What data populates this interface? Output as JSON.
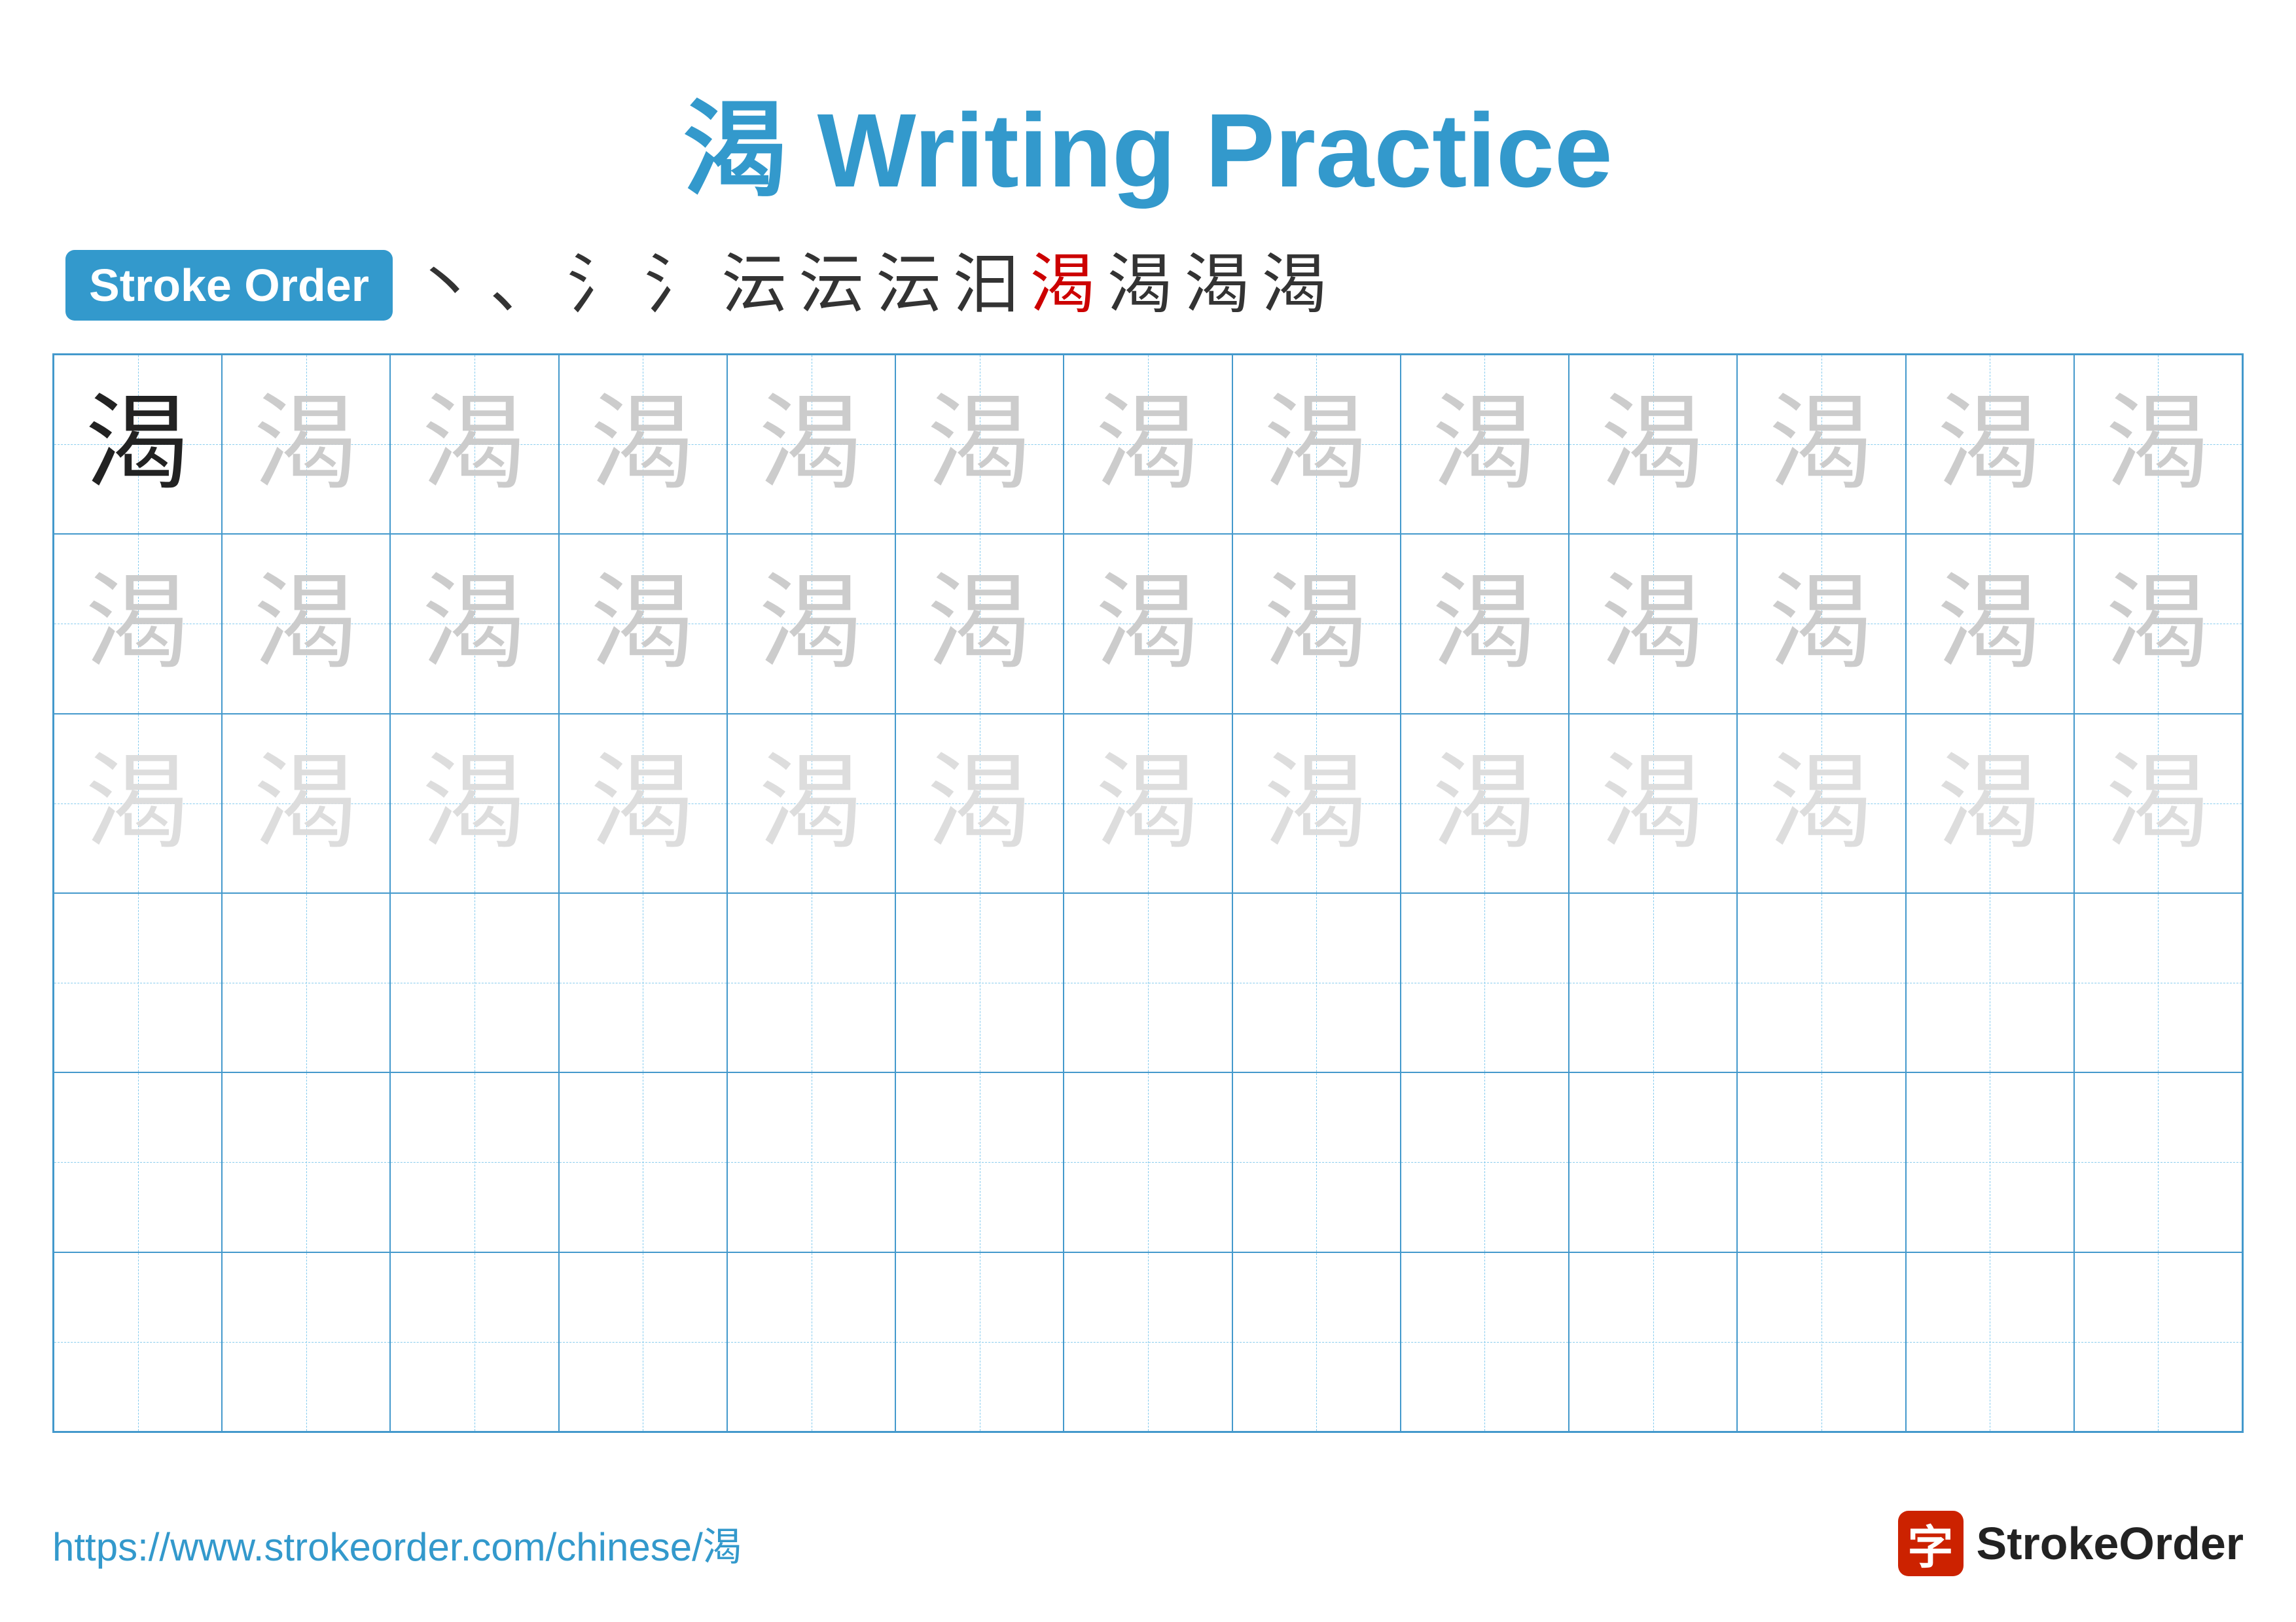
{
  "title": "渴 Writing Practice",
  "stroke_order_badge": "Stroke Order",
  "stroke_chars": [
    {
      "char": "丶",
      "style": "normal"
    },
    {
      "char": "丶",
      "style": "normal"
    },
    {
      "char": "氵",
      "style": "normal"
    },
    {
      "char": "氵",
      "style": "normal"
    },
    {
      "char": "氿",
      "style": "normal"
    },
    {
      "char": "氿",
      "style": "normal"
    },
    {
      "char": "汩",
      "style": "normal"
    },
    {
      "char": "汩",
      "style": "normal"
    },
    {
      "char": "渴",
      "style": "red"
    },
    {
      "char": "渴",
      "style": "normal"
    },
    {
      "char": "渴",
      "style": "normal"
    },
    {
      "char": "渴",
      "style": "normal"
    }
  ],
  "character": "渴",
  "grid_rows": 6,
  "grid_cols": 13,
  "footer_url": "https://www.strokeorder.com/chinese/渴",
  "footer_logo_char": "字",
  "footer_logo_text": "StrokeOrder",
  "row_styles": [
    [
      "solid",
      "light1",
      "light1",
      "light1",
      "light1",
      "light1",
      "light1",
      "light1",
      "light1",
      "light1",
      "light1",
      "light1",
      "light1"
    ],
    [
      "light1",
      "light1",
      "light1",
      "light1",
      "light1",
      "light1",
      "light1",
      "light1",
      "light1",
      "light1",
      "light1",
      "light1",
      "light1"
    ],
    [
      "light2",
      "light2",
      "light2",
      "light2",
      "light2",
      "light2",
      "light2",
      "light2",
      "light2",
      "light2",
      "light2",
      "light2",
      "light2"
    ],
    [
      "empty",
      "empty",
      "empty",
      "empty",
      "empty",
      "empty",
      "empty",
      "empty",
      "empty",
      "empty",
      "empty",
      "empty",
      "empty"
    ],
    [
      "empty",
      "empty",
      "empty",
      "empty",
      "empty",
      "empty",
      "empty",
      "empty",
      "empty",
      "empty",
      "empty",
      "empty",
      "empty"
    ],
    [
      "empty",
      "empty",
      "empty",
      "empty",
      "empty",
      "empty",
      "empty",
      "empty",
      "empty",
      "empty",
      "empty",
      "empty",
      "empty"
    ]
  ]
}
